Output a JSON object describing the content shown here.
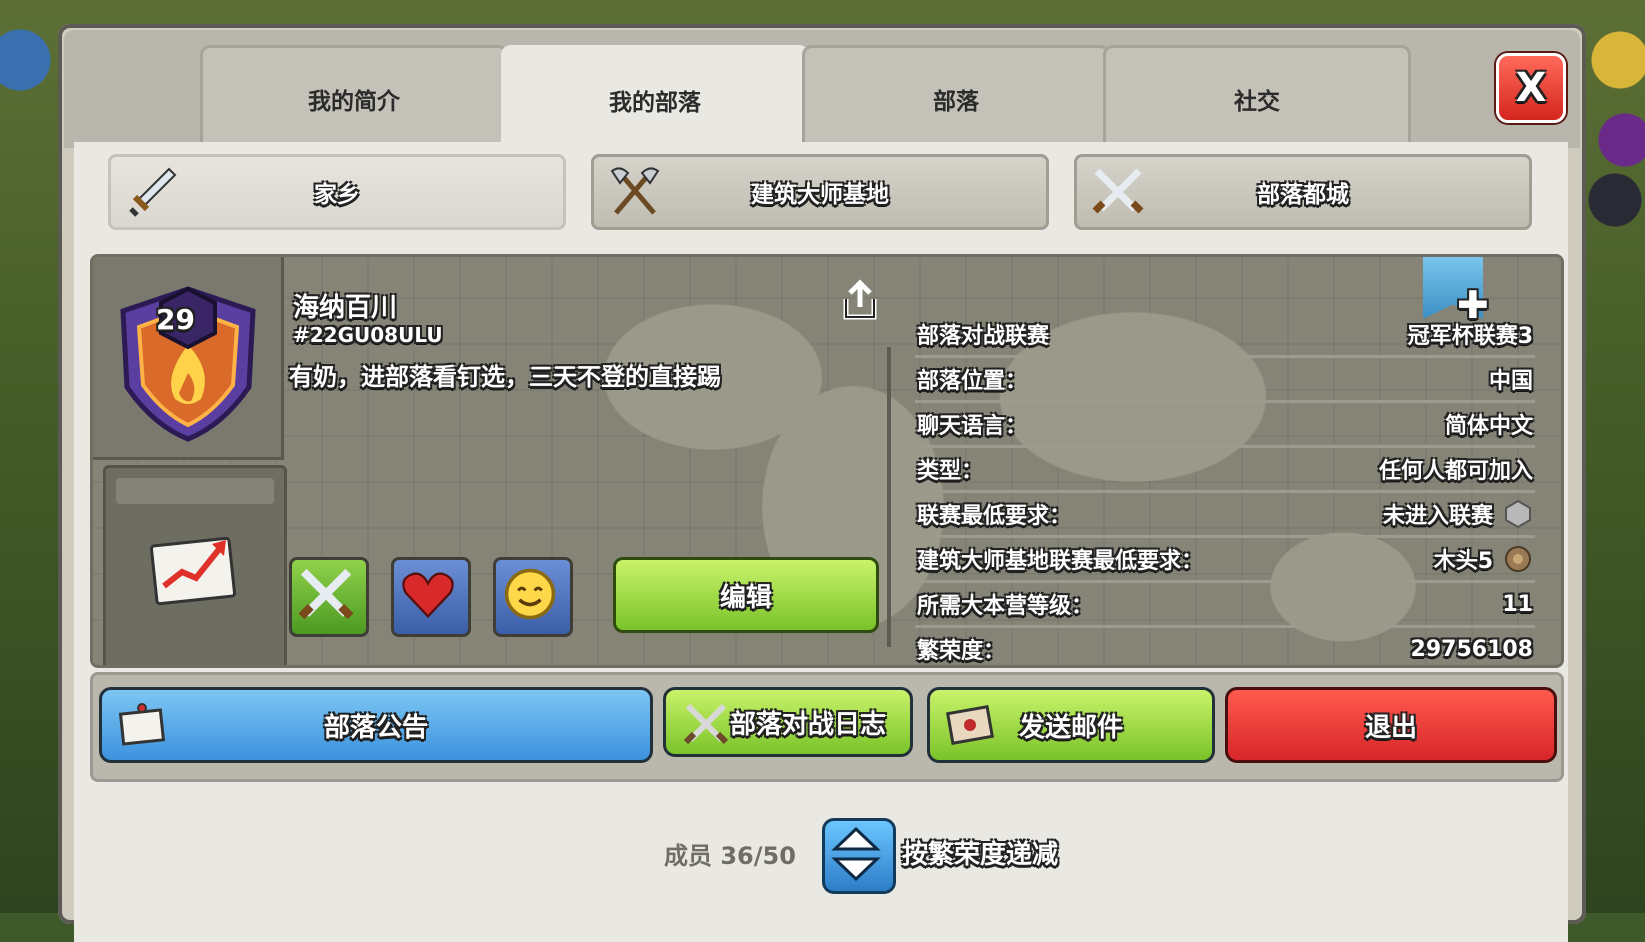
{
  "tabs": [
    "我的简介",
    "我的部落",
    "部落",
    "社交"
  ],
  "active_tab": "我的部落",
  "close_label": "X",
  "subtabs": [
    "家乡",
    "建筑大师基地",
    "部落都城"
  ],
  "clan": {
    "level": "29",
    "name": "海纳百川",
    "tag": "#22GU08ULU",
    "description": "有奶，进部落看钉选，三天不登的直接踢"
  },
  "properties": [
    {
      "label": "部落对战联赛",
      "value": "冠军杯联赛3"
    },
    {
      "label": "部落位置：",
      "value": "中国"
    },
    {
      "label": "聊天语言：",
      "value": "简体中文"
    },
    {
      "label": "类型：",
      "value": "任何人都可加入"
    },
    {
      "label": "联赛最低要求：",
      "value": "未进入联赛"
    },
    {
      "label": "建筑大师基地联赛最低要求：",
      "value": "木头5"
    },
    {
      "label": "所需大本营等级：",
      "value": "11"
    },
    {
      "label": "繁荣度：",
      "value": "29756108"
    }
  ],
  "buttons": {
    "edit": "编辑",
    "announcement": "部落公告",
    "war_log": "部落对战日志",
    "send_mail": "发送邮件",
    "leave": "退出"
  },
  "footer": {
    "members": "成员 36/50",
    "sort_label": "按繁荣度递减"
  },
  "colors": {
    "edit_green": "#7ac32a",
    "announce_blue": "#3c92dd",
    "leave_red": "#d8262a"
  }
}
